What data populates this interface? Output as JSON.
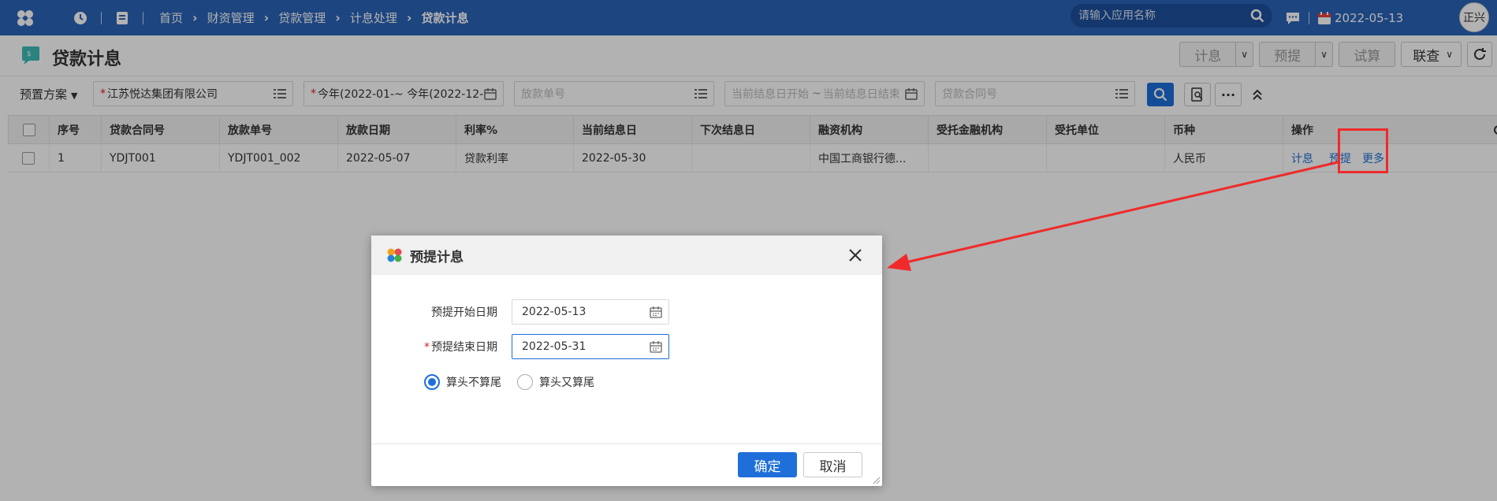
{
  "topbar": {
    "breadcrumbs": [
      "首页",
      "财资管理",
      "贷款管理",
      "计息处理",
      "贷款计息"
    ],
    "search_placeholder": "请输入应用名称",
    "date": "2022-05-13",
    "user": "正兴",
    "bg_color": "#2a64b8"
  },
  "page": {
    "title": "贷款计息",
    "buttons": {
      "accrue": "计息",
      "provision": "预提",
      "trial": "试算",
      "query": "联查"
    }
  },
  "filters": {
    "scheme": "预置方案",
    "company": "江苏悦达集团有限公司",
    "period": "今年(2022-01-~ 今年(2022-12-",
    "loan_no_ph": "放款单号",
    "settle_start_ph": "当前结息日开始",
    "settle_end_ph": "当前结息日结束",
    "contract_ph": "贷款合同号"
  },
  "table": {
    "headers": [
      "序号",
      "贷款合同号",
      "放款单号",
      "放款日期",
      "利率%",
      "当前结息日",
      "下次结息日",
      "融资机构",
      "受托金融机构",
      "受托单位",
      "币种",
      "操作"
    ],
    "rows": [
      [
        "1",
        "YDJT001",
        "YDJT001_002",
        "2022-05-07",
        "贷款利率",
        "2022-05-30",
        "",
        "中国工商银行德...",
        "",
        "",
        "人民币"
      ]
    ],
    "ops": [
      "计息",
      "预提",
      "更多"
    ]
  },
  "dialog": {
    "title": "预提计息",
    "start_label": "预提开始日期",
    "start_value": "2022-05-13",
    "end_label": "预提结束日期",
    "end_value": "2022-05-31",
    "radio1": "算头不算尾",
    "radio2": "算头又算尾",
    "ok": "确定",
    "cancel": "取消"
  },
  "colors": {
    "accent": "#1e6fd9",
    "annotation": "#f02a2a"
  }
}
